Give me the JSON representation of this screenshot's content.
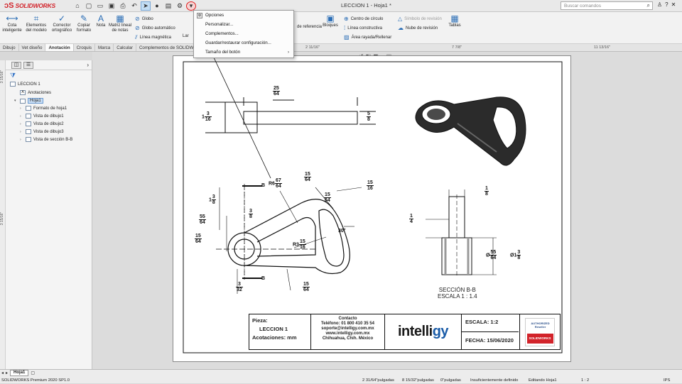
{
  "app": {
    "name": "SOLIDWORKS",
    "document_title": "LECCION 1 - Hoja1 *"
  },
  "search": {
    "placeholder": "Buscar comandos"
  },
  "ribbon": {
    "buttons": [
      {
        "label": "Cota inteligente",
        "icon": "smart-dimension-icon"
      },
      {
        "label": "Elementos del modelo",
        "icon": "model-items-icon"
      },
      {
        "label": "Corrector ortográfico",
        "icon": "spell-check-icon"
      },
      {
        "label": "Copiar formato",
        "icon": "format-painter-icon"
      },
      {
        "label": "Nota",
        "icon": "note-icon"
      },
      {
        "label": "Matriz lineal de notas",
        "icon": "linear-note-pattern-icon"
      }
    ],
    "small": [
      "Globo",
      "Globo automático",
      "Línea magnética"
    ],
    "right_small": [
      "Centro de círculo",
      "Línea constructiva",
      "Área rayada/Rellenar",
      "Símbolo de revisión",
      "Nube de revisión"
    ],
    "right_buttons": [
      "Bloques",
      "Tablas"
    ],
    "cut_labels": [
      "Lar",
      "de referencia"
    ]
  },
  "tabs": [
    "Dibujo",
    "Vet diseño",
    "Anotación",
    "Croquis",
    "Marca",
    "Calcular",
    "Complementos de SOLIDWORKS"
  ],
  "active_tab": "Anotación",
  "rulers": {
    "top": [
      "2 11/16\"",
      "7 7/8\"",
      "11 13/16\""
    ],
    "left": [
      "3 15/16\"",
      "3 15/16\""
    ]
  },
  "tree": {
    "root": "LECCION 1",
    "items": [
      {
        "label": "Anotaciones",
        "level": 1
      },
      {
        "label": "Hoja1",
        "level": 1
      },
      {
        "label": "Formato de hoja1",
        "level": 2
      },
      {
        "label": "Vista de dibujo1",
        "level": 2
      },
      {
        "label": "Vista de dibujo2",
        "level": 2
      },
      {
        "label": "Vista de dibujo3",
        "level": 2
      },
      {
        "label": "Vista de sección B-B",
        "level": 2
      }
    ]
  },
  "dropdown": {
    "items": [
      "Opciones",
      "Personalizar...",
      "Complementos...",
      "Guardar/restaurar configuración...",
      "Tamaño del botón"
    ]
  },
  "drawing": {
    "dims": {
      "d_25_64": {
        "n": "25",
        "d": "64"
      },
      "d_3_16": {
        "w": "1",
        "n": "3",
        "d": "16"
      },
      "d_5_8": {
        "n": "5",
        "d": "8"
      },
      "d_r6_67_64": {
        "pre": "R6",
        "n": "67",
        "d": "64"
      },
      "d_15_64_top": {
        "n": "15",
        "d": "64"
      },
      "d_15_16_r": {
        "n": "15",
        "d": "16"
      },
      "d_1_3_8": {
        "w": "1",
        "n": "3",
        "d": "8"
      },
      "d_3_8_small": {
        "n": "3",
        "d": "8"
      },
      "d_15_64_mid": {
        "n": "15",
        "d": "64"
      },
      "d_55_64_l": {
        "n": "55",
        "d": "64"
      },
      "d_15_64_l": {
        "n": "15",
        "d": "64"
      },
      "d_r3_15_16": {
        "pre": "R3",
        "n": "15",
        "d": "16"
      },
      "d_30": "30°",
      "d_3_32": {
        "n": "3",
        "d": "32"
      },
      "d_15_64_b": {
        "n": "15",
        "d": "64"
      },
      "d_1_8": {
        "n": "1",
        "d": "8"
      },
      "d_1_4": {
        "n": "1",
        "d": "4"
      },
      "d_55_64_r": {
        "pre": "Ø",
        "n": "55",
        "d": "64"
      },
      "d_1_3_8_r": {
        "pre": "Ø1",
        "n": "3",
        "d": "8"
      }
    },
    "section_marker_top": "B",
    "section_marker_bottom": "B",
    "section_title": "SECCIÓN B-B",
    "section_scale": "ESCALA 1 : 1.4"
  },
  "title_block": {
    "pieza_label": "Pieza:",
    "pieza_value": "LECCION 1",
    "acotaciones": "Acotaciones: mm",
    "contact_title": "Contacto",
    "phone": "Teléfono: 01 800 410 35 54",
    "email": "soporte@intelligy.com.mx",
    "web": "www.intelligy.com.mx",
    "city": "Chihuahua, Chih. México",
    "brand_main": "intelli",
    "brand_accent": "gy",
    "escala": "ESCALA: 1:2",
    "fecha": "FECHA: 15/06/2020",
    "badge_top": "AUTHORIZED Reseller",
    "badge_bottom": "SOLIDWORKS"
  },
  "sheet_tab": "Hoja1",
  "status": {
    "version": "SOLIDWORKS Premium 2020 SP1.0",
    "x": "2 31/64\"pulgadas",
    "y": "8 15/32\"pulgadas",
    "z": "0\"pulgadas",
    "state": "Insuficientemente definido",
    "editing": "Editando Hoja1",
    "scale": "1 : 2",
    "units": "IPS"
  }
}
